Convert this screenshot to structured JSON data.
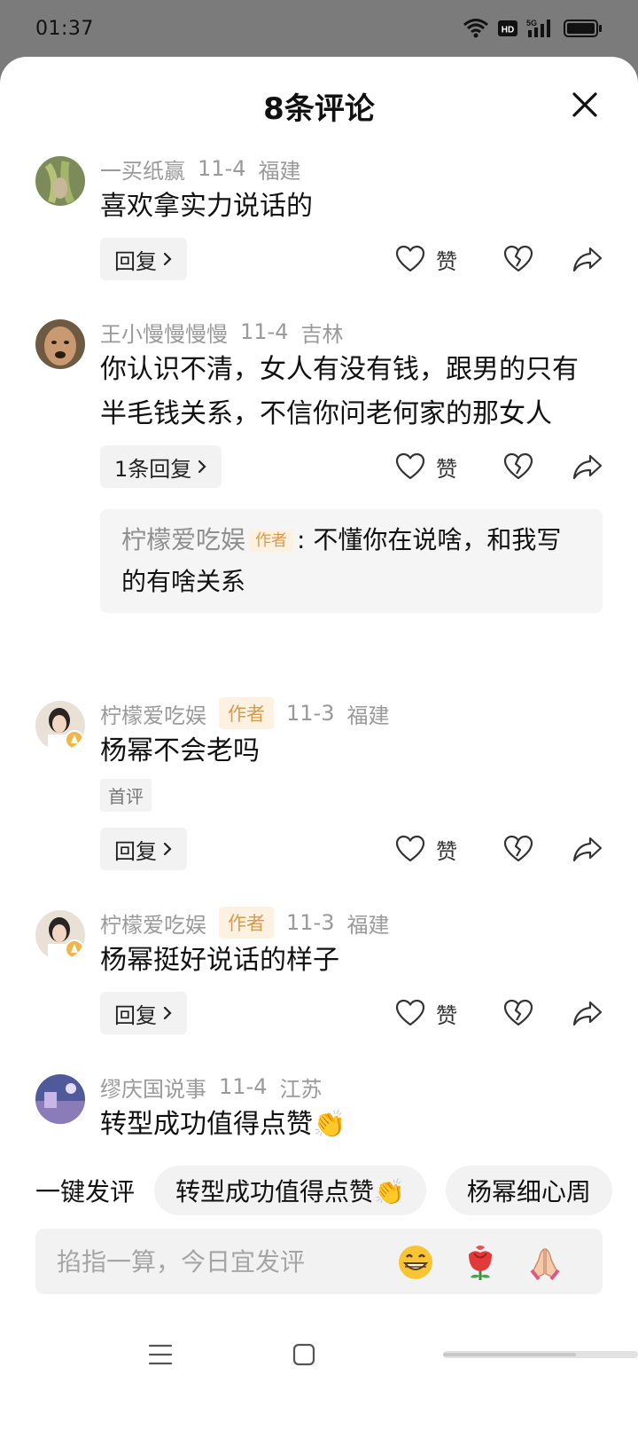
{
  "status_bar": {
    "time": "01:37",
    "network_label": "5G",
    "hd_label": "HD"
  },
  "sheet": {
    "title": "8条评论"
  },
  "comments": [
    {
      "username": "一买纸赢",
      "date": "11-4",
      "location": "福建",
      "text": "喜欢拿实力说话的",
      "reply_label": "回复",
      "like_label": "赞"
    },
    {
      "username": "王小慢慢慢慢",
      "date": "11-4",
      "location": "吉林",
      "text": "你认识不清，女人有没有钱，跟男的只有半毛钱关系，不信你问老何家的那女人",
      "reply_label": "1条回复",
      "like_label": "赞",
      "sub_reply": {
        "username": "柠檬爱吃娱",
        "tag": "作者",
        "text": ": 不懂你在说啥，和我写的有啥关系"
      }
    },
    {
      "username": "柠檬爱吃娱",
      "author_tag": "作者",
      "date": "11-3",
      "location": "福建",
      "text": "杨幂不会老吗",
      "badge": "首评",
      "reply_label": "回复",
      "like_label": "赞"
    },
    {
      "username": "柠檬爱吃娱",
      "author_tag": "作者",
      "date": "11-3",
      "location": "福建",
      "text": "杨幂挺好说话的样子",
      "reply_label": "回复",
      "like_label": "赞"
    },
    {
      "username": "缪庆国说事",
      "date": "11-4",
      "location": "江苏",
      "text": "转型成功值得点赞👏"
    }
  ],
  "quick_comment": {
    "label": "一键发评",
    "chips": [
      "转型成功值得点赞👏",
      "杨幂细心周"
    ]
  },
  "input": {
    "placeholder": "掐指一算，今日宜发评"
  },
  "colors": {
    "author_tag_bg": "#fdf1e2",
    "author_tag_text": "#d99a4c",
    "muted_text": "#9a9a9a"
  },
  "icons": [
    "wifi-icon",
    "hd-icon",
    "signal-icon",
    "battery-icon",
    "close-icon",
    "heart-icon",
    "broken-heart-icon",
    "share-icon",
    "chevron-right-icon",
    "grin-emoji-icon",
    "rose-emoji-icon",
    "pray-emoji-icon",
    "menu-icon",
    "home-icon",
    "gesture-bar-icon"
  ]
}
